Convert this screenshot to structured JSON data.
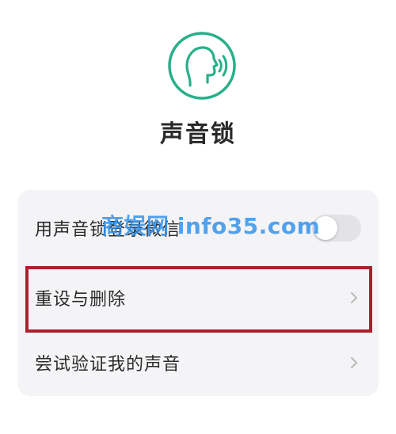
{
  "header": {
    "icon": "voice-profile-icon",
    "title": "声音锁"
  },
  "settings": {
    "items": [
      {
        "label": "用声音锁登录微信",
        "control": "toggle",
        "toggle_on": false
      },
      {
        "label": "重设与删除",
        "control": "chevron-right-icon"
      },
      {
        "label": "尝试验证我的声音",
        "control": "chevron-right-icon"
      }
    ]
  },
  "overlay": {
    "watermark_text": "商娱网 info35.com",
    "highlight_color": "#b01e2e",
    "watermark_color": "#2e8fea"
  },
  "colors": {
    "accent_green": "#27b089",
    "card_background": "#f4f4f6"
  }
}
